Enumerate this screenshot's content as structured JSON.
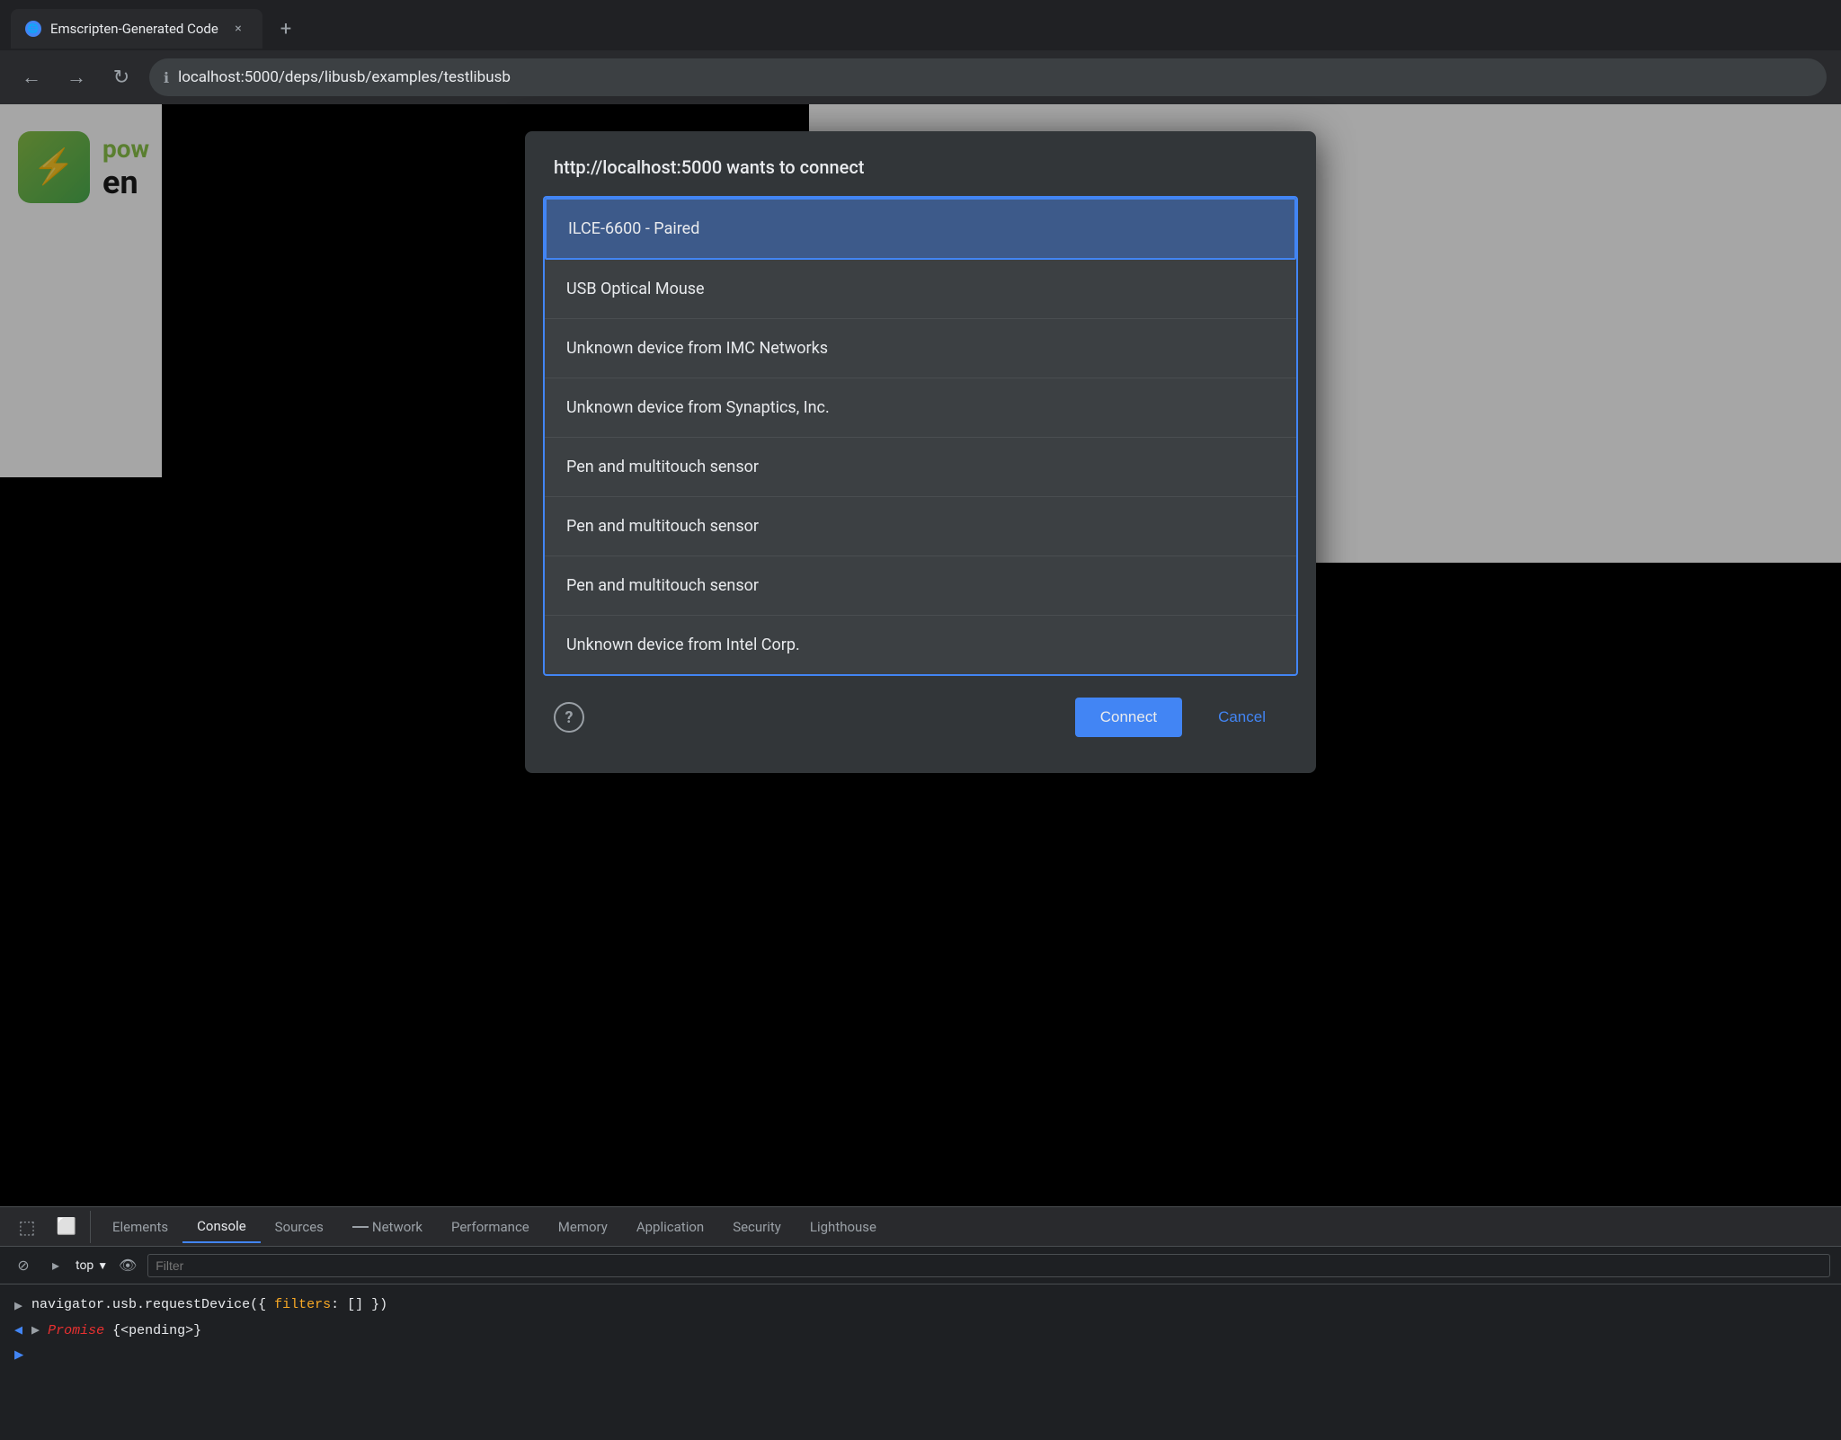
{
  "browser": {
    "tab": {
      "favicon": "🌐",
      "title": "Emscripten-Generated Code",
      "close_label": "×",
      "new_tab_label": "+"
    },
    "nav": {
      "back_label": "←",
      "forward_label": "→",
      "reload_label": "↻",
      "address": "localhost:5000/deps/libusb/examples/testlibusb"
    }
  },
  "app": {
    "icon_label": "⚡",
    "name_pow": "pow",
    "name_en": "en"
  },
  "dialog": {
    "title": "http://localhost:5000 wants to connect",
    "devices": [
      {
        "label": "ILCE-6600 - Paired",
        "selected": true
      },
      {
        "label": "USB Optical Mouse",
        "selected": false
      },
      {
        "label": "Unknown device from IMC Networks",
        "selected": false
      },
      {
        "label": "Unknown device from Synaptics, Inc.",
        "selected": false
      },
      {
        "label": "Pen and multitouch sensor",
        "selected": false
      },
      {
        "label": "Pen and multitouch sensor",
        "selected": false
      },
      {
        "label": "Pen and multitouch sensor",
        "selected": false
      },
      {
        "label": "Unknown device from Intel Corp.",
        "selected": false
      }
    ],
    "help_label": "?",
    "connect_label": "Connect",
    "cancel_label": "Cancel"
  },
  "devtools": {
    "tabs": [
      {
        "label": "Elements",
        "active": false
      },
      {
        "label": "Console",
        "active": true
      },
      {
        "label": "Sources",
        "active": false
      },
      {
        "label": "Network",
        "active": false
      },
      {
        "label": "Performance",
        "active": false
      },
      {
        "label": "Memory",
        "active": false
      },
      {
        "label": "Application",
        "active": false
      },
      {
        "label": "Security",
        "active": false
      },
      {
        "label": "Lighthouse",
        "active": false
      }
    ],
    "toolbar": {
      "context_label": "top",
      "filter_placeholder": "Filter"
    },
    "console": {
      "input_code": "navigator.usb.requestDevice({ filters: [] })",
      "output_type": "Promise",
      "output_value": "{<pending>}"
    }
  }
}
